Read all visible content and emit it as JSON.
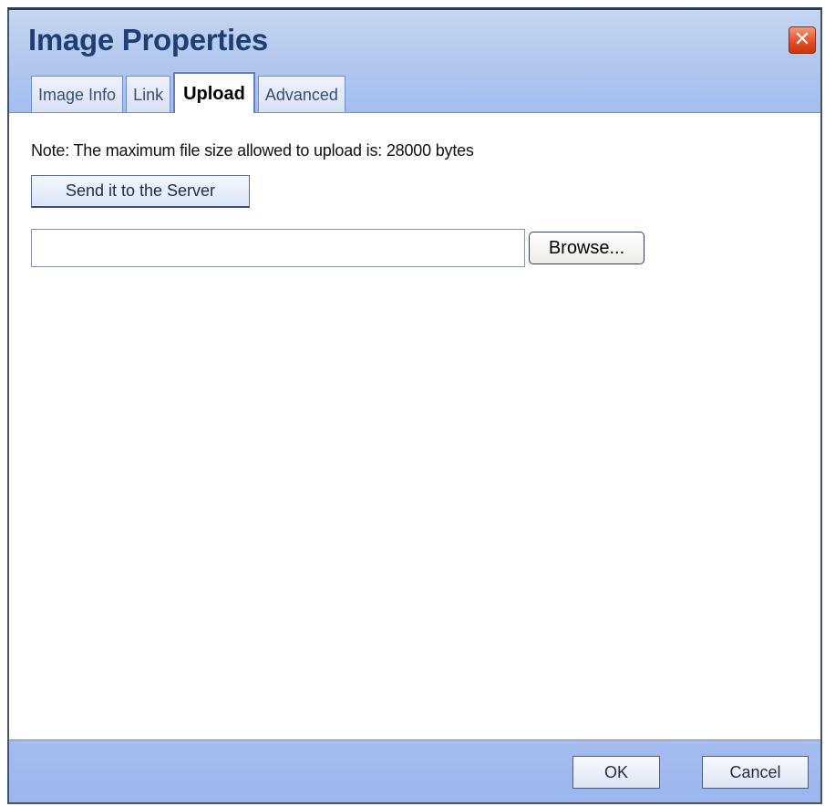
{
  "dialog": {
    "title": "Image Properties",
    "close_symbol": "✕"
  },
  "tabs": [
    {
      "label": "Image Info",
      "active": false
    },
    {
      "label": "Link",
      "active": false
    },
    {
      "label": "Upload",
      "active": true
    },
    {
      "label": "Advanced",
      "active": false
    }
  ],
  "upload": {
    "note": "Note: The maximum file size allowed to upload is: 28000 bytes",
    "send_button_label": "Send it to the Server",
    "file_value": "",
    "browse_button_label": "Browse..."
  },
  "footer": {
    "ok_label": "OK",
    "cancel_label": "Cancel"
  },
  "colors": {
    "title_text": "#1f3f73",
    "header_bg": "#b6caef",
    "footer_bg": "#a6bcef",
    "close_button": "#e4552f"
  },
  "icons": {
    "close": "close-icon"
  }
}
